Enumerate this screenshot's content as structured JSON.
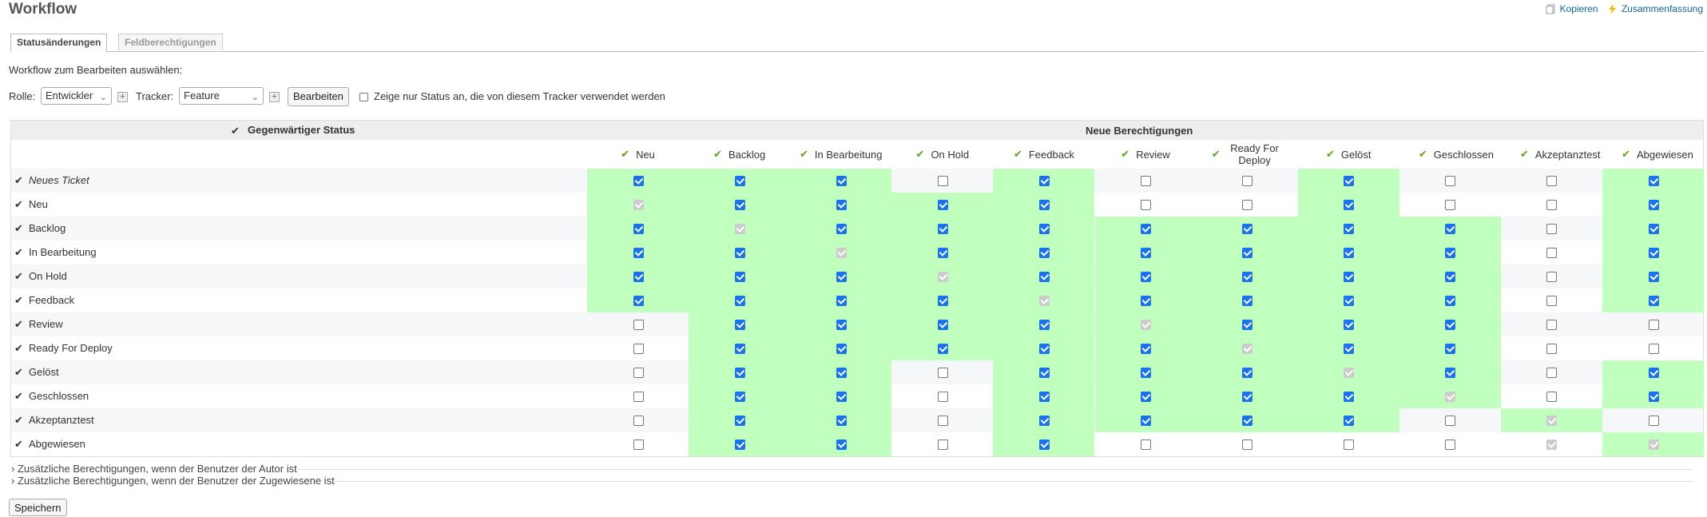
{
  "title": "Workflow",
  "actions": {
    "copy": "Kopieren",
    "summary": "Zusammenfassung"
  },
  "tabs": [
    "Statusänderungen",
    "Feldberechtigungen"
  ],
  "select_label": "Workflow zum Bearbeiten auswählen:",
  "filters": {
    "role_label": "Rolle:",
    "role_value": "Entwickler",
    "tracker_label": "Tracker:",
    "tracker_value": "Feature",
    "edit_button": "Bearbeiten",
    "used_only_label": "Zeige nur Status an, die von diesem Tracker verwendet werden"
  },
  "table": {
    "current_status_header": "Gegenwärtiger Status",
    "new_permissions_header": "Neue Berechtigungen",
    "columns": [
      "Neu",
      "Backlog",
      "In Bearbeitung",
      "On Hold",
      "Feedback",
      "Review",
      "Ready For Deploy",
      "Gelöst",
      "Geschlossen",
      "Akzeptanztest",
      "Abgewiesen"
    ],
    "rows": [
      {
        "label": "Neues Ticket",
        "italic": true,
        "cells": "ccc-cn--c-c-c",
        "state": "11101001001"
      },
      {
        "label": "Neu"
      },
      {
        "label": "Backlog"
      },
      {
        "label": "In Bearbeitung"
      },
      {
        "label": "On Hold"
      },
      {
        "label": "Feedback"
      },
      {
        "label": "Review"
      },
      {
        "label": "Ready For Deploy"
      },
      {
        "label": "Gelöst"
      },
      {
        "label": "Geschlossen"
      },
      {
        "label": "Akzeptanztest"
      },
      {
        "label": "Abgewiesen"
      }
    ],
    "state": [
      "11101001001",
      "d1111001001",
      "1d111111101",
      "11d11111101",
      "111d1111101",
      "1111d111101",
      "01111d11100",
      "011111d1100",
      "0110111d101",
      "01101111d01",
      "011011110d0",
      "011010000d?"
    ],
    "green": [
      "11101001001",
      "11111001001",
      "11111111101",
      "11111111101",
      "11111111101",
      "11111111101",
      "01111111100",
      "01111111100",
      "01101111101",
      "01101111101",
      "01101111010",
      "01101000001"
    ]
  },
  "collapsibles": [
    "Zusätzliche Berechtigungen, wenn der Benutzer der Autor ist",
    "Zusätzliche Berechtigungen, wenn der Benutzer der Zugewiesene ist"
  ],
  "save_button": "Speichern"
}
